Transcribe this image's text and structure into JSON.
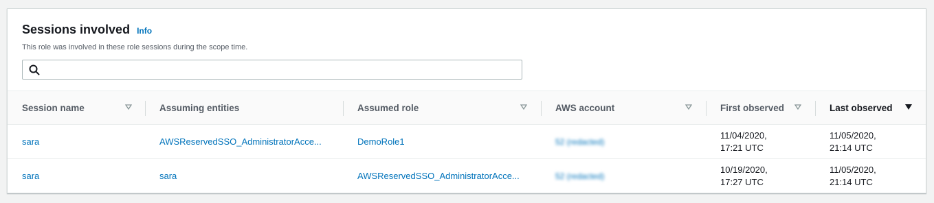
{
  "panel": {
    "title": "Sessions involved",
    "info_link": "Info",
    "description": "This role was involved in these role sessions during the scope time."
  },
  "search": {
    "value": "",
    "placeholder": ""
  },
  "table": {
    "columns": [
      {
        "label": "Session name",
        "sort": "sortable"
      },
      {
        "label": "Assuming entities",
        "sort": "none"
      },
      {
        "label": "Assumed role",
        "sort": "sortable"
      },
      {
        "label": "AWS account",
        "sort": "sortable"
      },
      {
        "label": "First observed",
        "sort": "sortable"
      },
      {
        "label": "Last observed",
        "sort": "descending"
      }
    ],
    "rows": [
      {
        "session_name": "sara",
        "assuming_entities": "AWSReservedSSO_AdministratorAcce...",
        "assumed_role": "DemoRole1",
        "aws_account": "52 (redacted)",
        "first_observed_date": "11/04/2020,",
        "first_observed_time": "17:21 UTC",
        "last_observed_date": "11/05/2020,",
        "last_observed_time": "21:14 UTC"
      },
      {
        "session_name": "sara",
        "assuming_entities": "sara",
        "assumed_role": "AWSReservedSSO_AdministratorAcce...",
        "aws_account": "52 (redacted)",
        "first_observed_date": "10/19/2020,",
        "first_observed_time": "17:27 UTC",
        "last_observed_date": "11/05/2020,",
        "last_observed_time": "21:14 UTC"
      }
    ]
  },
  "colors": {
    "link": "#0073bb",
    "text": "#16191f",
    "muted": "#545b64",
    "border": "#d5dbdb",
    "background": "#f2f3f3"
  },
  "icons": {
    "search": "search-icon",
    "sortable": "caret-down-outline-icon",
    "sorted_desc": "caret-down-filled-icon"
  }
}
